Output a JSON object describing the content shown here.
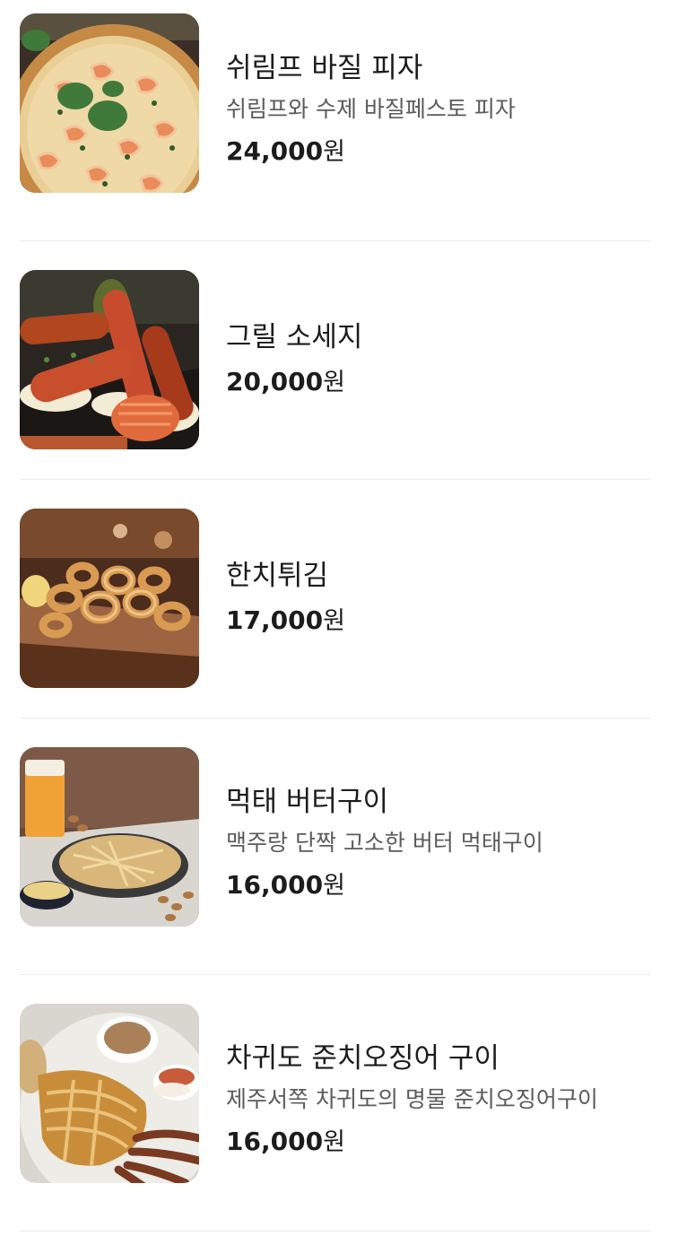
{
  "menu": {
    "currency_unit": "원",
    "items": [
      {
        "name": "쉬림프 바질 피자",
        "description": "쉬림프와 수제 바질페스토 피자",
        "price": "24,000",
        "image": "shrimp-basil-pizza-image"
      },
      {
        "name": "그릴 소세지",
        "description": "",
        "price": "20,000",
        "image": "grilled-sausage-image"
      },
      {
        "name": "한치튀김",
        "description": "",
        "price": "17,000",
        "image": "fried-squid-image"
      },
      {
        "name": "먹태 버터구이",
        "description": "맥주랑 단짝 고소한 버터 먹태구이",
        "price": "16,000",
        "image": "butter-grilled-pollock-image"
      },
      {
        "name": "차귀도 준치오징어 구이",
        "description": "제주서쪽 차귀도의 명물 준치오징어구이",
        "price": "16,000",
        "image": "grilled-squid-image"
      }
    ]
  }
}
